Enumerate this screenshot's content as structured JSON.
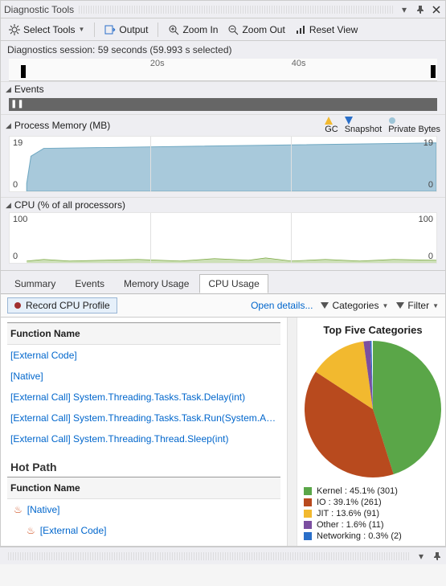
{
  "window": {
    "title": "Diagnostic Tools"
  },
  "toolbar": {
    "select_tools": "Select Tools",
    "output": "Output",
    "zoom_in": "Zoom In",
    "zoom_out": "Zoom Out",
    "reset_view": "Reset View"
  },
  "session": {
    "text": "Diagnostics session: 59 seconds (59.993 s selected)"
  },
  "ruler": {
    "ticks": [
      "20s",
      "40s"
    ]
  },
  "sections": {
    "events": "Events",
    "memory": "Process Memory (MB)",
    "cpu": "CPU (% of all processors)"
  },
  "memory_legend": {
    "gc": "GC",
    "snapshot": "Snapshot",
    "private": "Private Bytes"
  },
  "memory_axis": {
    "top": "19",
    "bottom": "0"
  },
  "cpu_axis": {
    "top": "100",
    "bottom": "0"
  },
  "tabs": {
    "summary": "Summary",
    "events": "Events",
    "memory": "Memory Usage",
    "cpu": "CPU Usage",
    "active": "cpu"
  },
  "subbar": {
    "record": "Record CPU Profile",
    "open_details": "Open details...",
    "categories": "Categories",
    "filter": "Filter"
  },
  "function_table": {
    "header": "Function Name",
    "rows": [
      "[External Code]",
      "[Native]",
      "[External Call] System.Threading.Tasks.Task.Delay(int)",
      "[External Call] System.Threading.Tasks.Task.Run(System.Action)",
      "[External Call] System.Threading.Thread.Sleep(int)"
    ]
  },
  "hot_path": {
    "title": "Hot Path",
    "header": "Function Name",
    "rows": [
      "[Native]",
      "[External Code]"
    ]
  },
  "pie": {
    "title": "Top Five Categories",
    "items": [
      {
        "label": "Kernel : 45.1% (301)",
        "color": "#5aa648",
        "pct": 45.1
      },
      {
        "label": "IO : 39.1% (261)",
        "color": "#b84a1e",
        "pct": 39.1
      },
      {
        "label": "JIT : 13.6% (91)",
        "color": "#f2b92f",
        "pct": 13.6
      },
      {
        "label": "Other : 1.6% (11)",
        "color": "#7b4fa0",
        "pct": 1.6
      },
      {
        "label": "Networking : 0.3% (2)",
        "color": "#2a6fc9",
        "pct": 0.3
      }
    ]
  },
  "chart_data": [
    {
      "type": "area",
      "title": "Process Memory (MB)",
      "ylabel": "MB",
      "ylim": [
        0,
        19
      ],
      "x_range_seconds": [
        0,
        60
      ],
      "series": [
        {
          "name": "Private Bytes",
          "x": [
            0,
            2,
            5,
            10,
            20,
            30,
            40,
            50,
            59
          ],
          "values": [
            4,
            12,
            14,
            14,
            15,
            15,
            16,
            16,
            17
          ]
        }
      ]
    },
    {
      "type": "line",
      "title": "CPU (% of all processors)",
      "ylabel": "%",
      "ylim": [
        0,
        100
      ],
      "x_range_seconds": [
        0,
        60
      ],
      "series": [
        {
          "name": "CPU",
          "x": [
            0,
            5,
            10,
            15,
            20,
            25,
            30,
            35,
            40,
            45,
            50,
            55,
            59
          ],
          "values": [
            2,
            3,
            2,
            2,
            3,
            2,
            4,
            3,
            5,
            2,
            2,
            3,
            2
          ]
        }
      ]
    },
    {
      "type": "pie",
      "title": "Top Five Categories",
      "categories": [
        "Kernel",
        "IO",
        "JIT",
        "Other",
        "Networking"
      ],
      "values": [
        45.1,
        39.1,
        13.6,
        1.6,
        0.3
      ],
      "counts": [
        301,
        261,
        91,
        11,
        2
      ]
    }
  ]
}
